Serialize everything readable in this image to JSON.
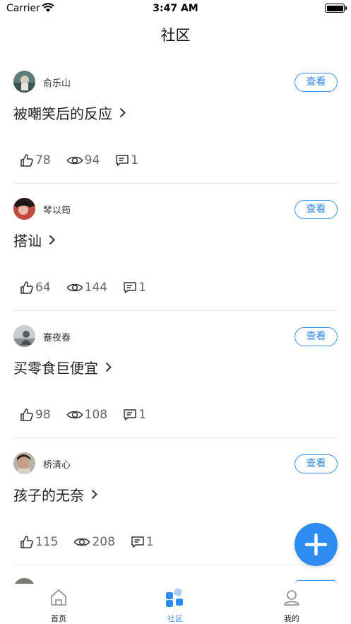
{
  "status_bar": {
    "carrier": "Carrier",
    "time": "3:47 AM"
  },
  "nav": {
    "title": "社区"
  },
  "colors": {
    "accent": "#2c8cf2",
    "text": "#222222",
    "muted": "#666666",
    "divider": "#e8e8e8"
  },
  "posts": [
    {
      "author": "俞乐山",
      "title": "被嘲笑后的反应",
      "view_label": "查看",
      "likes": "78",
      "views": "94",
      "comments": "1"
    },
    {
      "author": "琴以筠",
      "title": "搭讪",
      "view_label": "查看",
      "likes": "64",
      "views": "144",
      "comments": "1"
    },
    {
      "author": "蹇夜春",
      "title": "买零食巨便宜",
      "view_label": "查看",
      "likes": "98",
      "views": "108",
      "comments": "1"
    },
    {
      "author": "桥清心",
      "title": "孩子的无奈",
      "view_label": "查看",
      "likes": "115",
      "views": "208",
      "comments": "1"
    }
  ],
  "fab": {
    "icon": "plus-icon"
  },
  "tabs": [
    {
      "label": "首页",
      "icon": "home-icon"
    },
    {
      "label": "社区",
      "icon": "community-icon",
      "active": true
    },
    {
      "label": "我的",
      "icon": "profile-icon"
    }
  ]
}
